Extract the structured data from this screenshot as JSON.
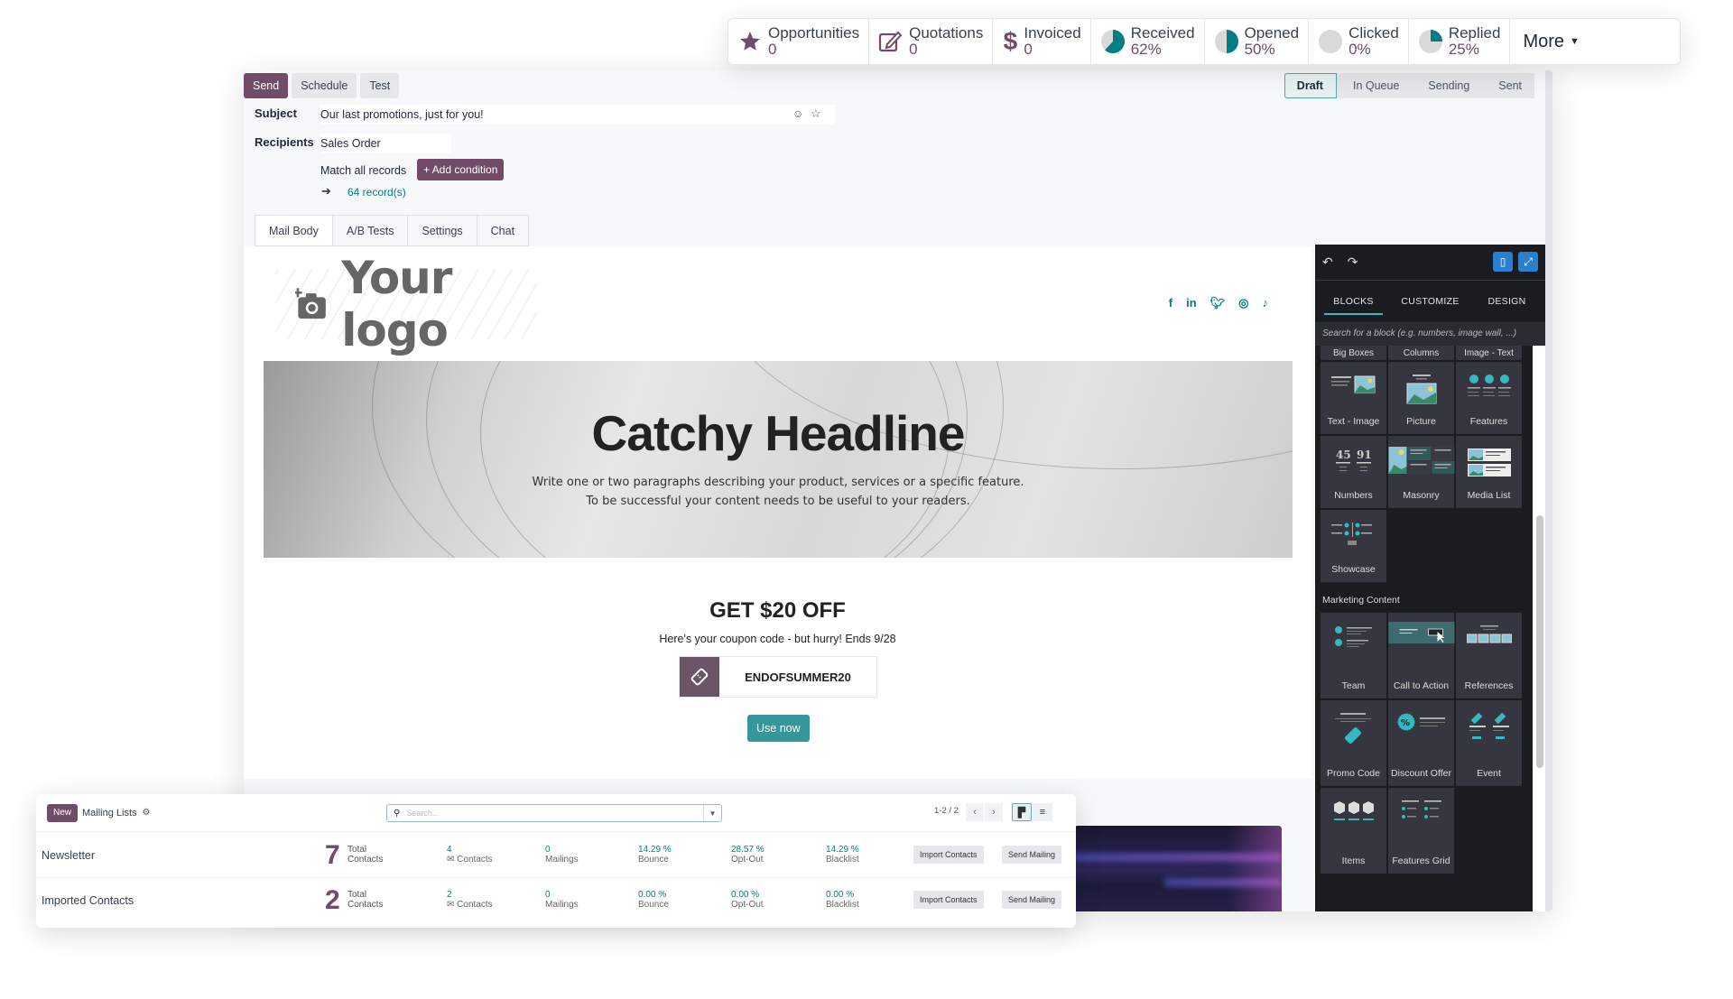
{
  "stats_bar": {
    "items": [
      {
        "icon": "star-icon",
        "label": "Opportunities",
        "value": "0"
      },
      {
        "icon": "edit-icon",
        "label": "Quotations",
        "value": "0"
      },
      {
        "icon": "dollar-icon",
        "label": "Invoiced",
        "value": "0"
      },
      {
        "icon": "pie-icon",
        "label": "Received",
        "value": "62%",
        "fraction": 0.62
      },
      {
        "icon": "pie-icon",
        "label": "Opened",
        "value": "50%",
        "fraction": 0.5
      },
      {
        "icon": "pie-icon",
        "label": "Clicked",
        "value": "0%",
        "fraction": 0
      },
      {
        "icon": "pie-icon",
        "label": "Replied",
        "value": "25%",
        "fraction": 0.25
      }
    ],
    "more_label": "More"
  },
  "actions": {
    "send": "Send",
    "schedule": "Schedule",
    "test": "Test"
  },
  "status_stages": [
    "Draft",
    "In Queue",
    "Sending",
    "Sent"
  ],
  "status_current": "Draft",
  "form": {
    "subject_label": "Subject",
    "subject_value": "Our last promotions, just for you!",
    "recipients_label": "Recipients",
    "recipients_value": "Sales Order",
    "match_text": "Match all records",
    "add_condition": "+ Add condition",
    "records_link": "64 record(s)"
  },
  "tabs": [
    "Mail Body",
    "A/B Tests",
    "Settings",
    "Chat"
  ],
  "email": {
    "logo_text": "Your logo",
    "social": [
      "f",
      "in",
      "♥",
      "▢",
      "♪"
    ],
    "hero_title": "Catchy Headline",
    "hero_line1": "Write one or two paragraphs describing your product, services or a specific feature.",
    "hero_line2": "To be successful your content needs to be useful to your readers.",
    "offer_title": "GET $20 OFF",
    "offer_sub": "Here's your coupon code - but hurry! Ends 9/28",
    "coupon_code": "ENDOFSUMMER20",
    "use_now": "Use now"
  },
  "sidebar": {
    "tabs": [
      "BLOCKS",
      "CUSTOMIZE",
      "DESIGN"
    ],
    "search_placeholder": "Search for a block (e.g. numbers, image wall, ...)",
    "partial_blocks": [
      "Big Boxes",
      "Columns",
      "Image - Text"
    ],
    "blocks": [
      "Text - Image",
      "Picture",
      "Features",
      "Numbers",
      "Masonry",
      "Media List",
      "Showcase"
    ],
    "section_title": "Marketing Content",
    "marketing_blocks": [
      "Team",
      "Call to Action",
      "References",
      "Promo Code",
      "Discount Offer",
      "Event",
      "Items",
      "Features Grid"
    ]
  },
  "mailing_lists": {
    "new_label": "New",
    "title": "Mailing Lists",
    "search_placeholder": "Search...",
    "pager": "1-2 / 2",
    "rows": [
      {
        "name": "Newsletter",
        "total": "7",
        "total_label": "Total Contacts",
        "contacts": "4",
        "contacts_label": "Contacts",
        "mailings": "0",
        "mailings_label": "Mailings",
        "bounce": "14.29 %",
        "bounce_label": "Bounce",
        "optout": "28.57 %",
        "optout_label": "Opt-Out",
        "blacklist": "14.29 %",
        "blacklist_label": "Blacklist",
        "import": "Import Contacts",
        "send": "Send Mailing"
      },
      {
        "name": "Imported Contacts",
        "total": "2",
        "total_label": "Total Contacts",
        "contacts": "2",
        "contacts_label": "Contacts",
        "mailings": "0",
        "mailings_label": "Mailings",
        "bounce": "0.00 %",
        "bounce_label": "Bounce",
        "optout": "0.00 %",
        "optout_label": "Opt-Out",
        "blacklist": "0.00 %",
        "blacklist_label": "Blacklist",
        "import": "Import Contacts",
        "send": "Send Mailing"
      }
    ]
  },
  "colors": {
    "brand": "#714b67",
    "accent": "#017e84",
    "pie_fill": "#017e84",
    "pie_bg": "#d9d9d9"
  }
}
